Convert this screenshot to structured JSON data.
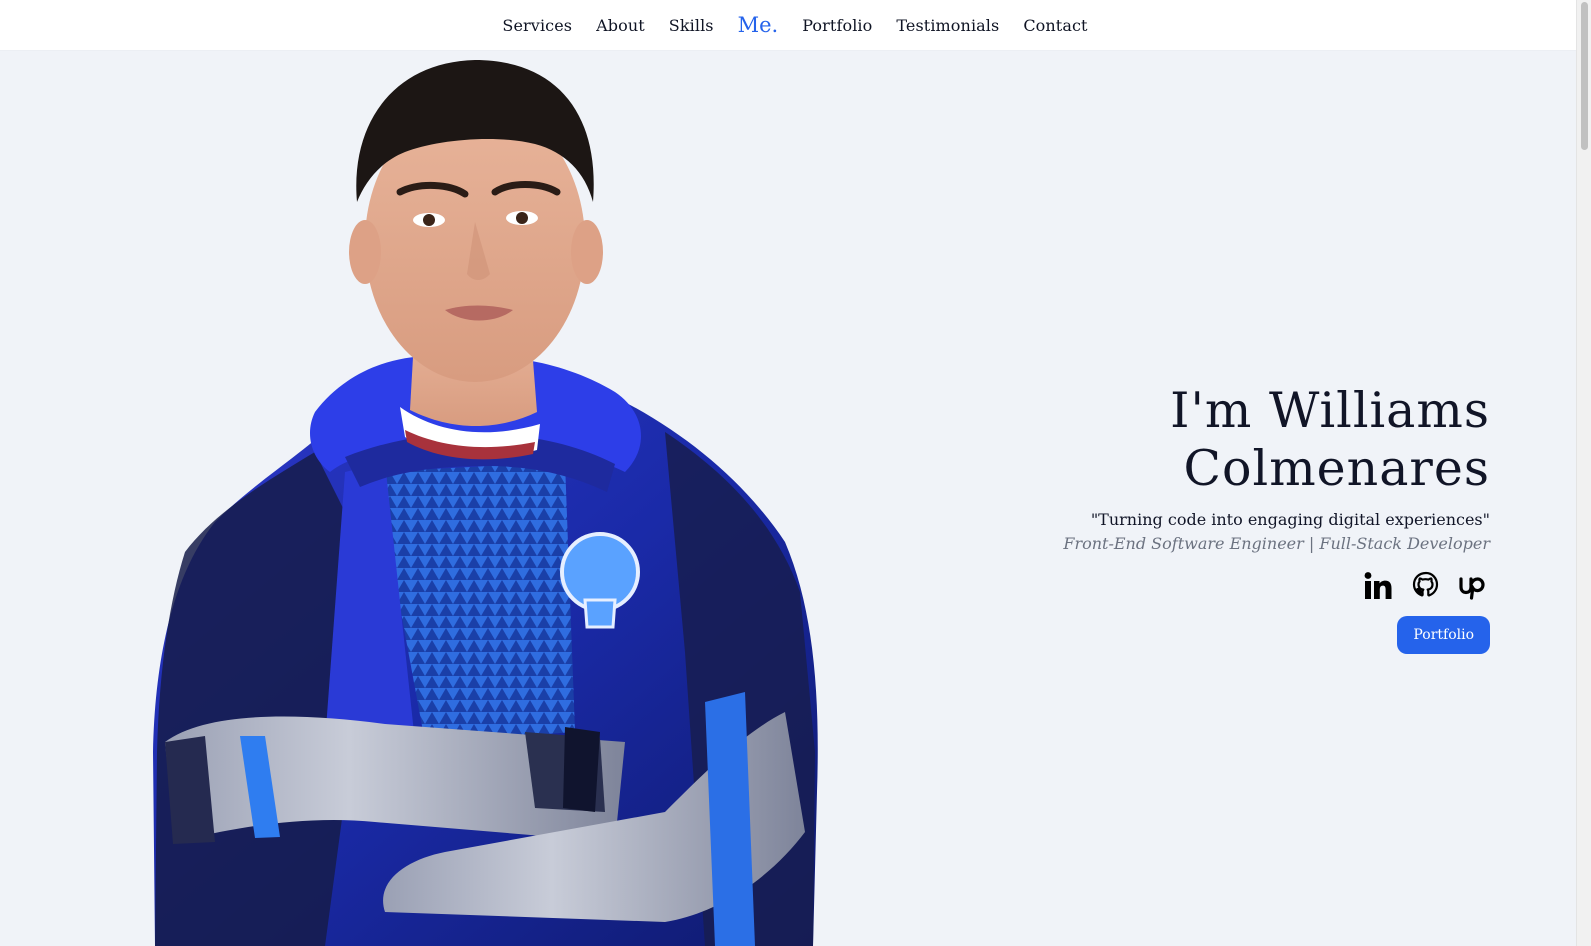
{
  "nav": {
    "items": [
      {
        "label": "Services"
      },
      {
        "label": "About"
      },
      {
        "label": "Skills"
      },
      {
        "label": "Portfolio"
      },
      {
        "label": "Testimonials"
      },
      {
        "label": "Contact"
      }
    ],
    "brand": "Me."
  },
  "hero": {
    "title": "I'm Williams Colmenares",
    "quote": "\"Turning code into engaging digital experiences\"",
    "role": "Front-End Software Engineer | Full-Stack Developer",
    "social": [
      {
        "icon": "linkedin-icon"
      },
      {
        "icon": "github-icon"
      },
      {
        "icon": "upwork-icon"
      }
    ],
    "cta_label": "Portfolio"
  },
  "colors": {
    "accent": "#2563eb",
    "background": "#f0f3f8",
    "text": "#111527",
    "muted": "#6b7280"
  }
}
